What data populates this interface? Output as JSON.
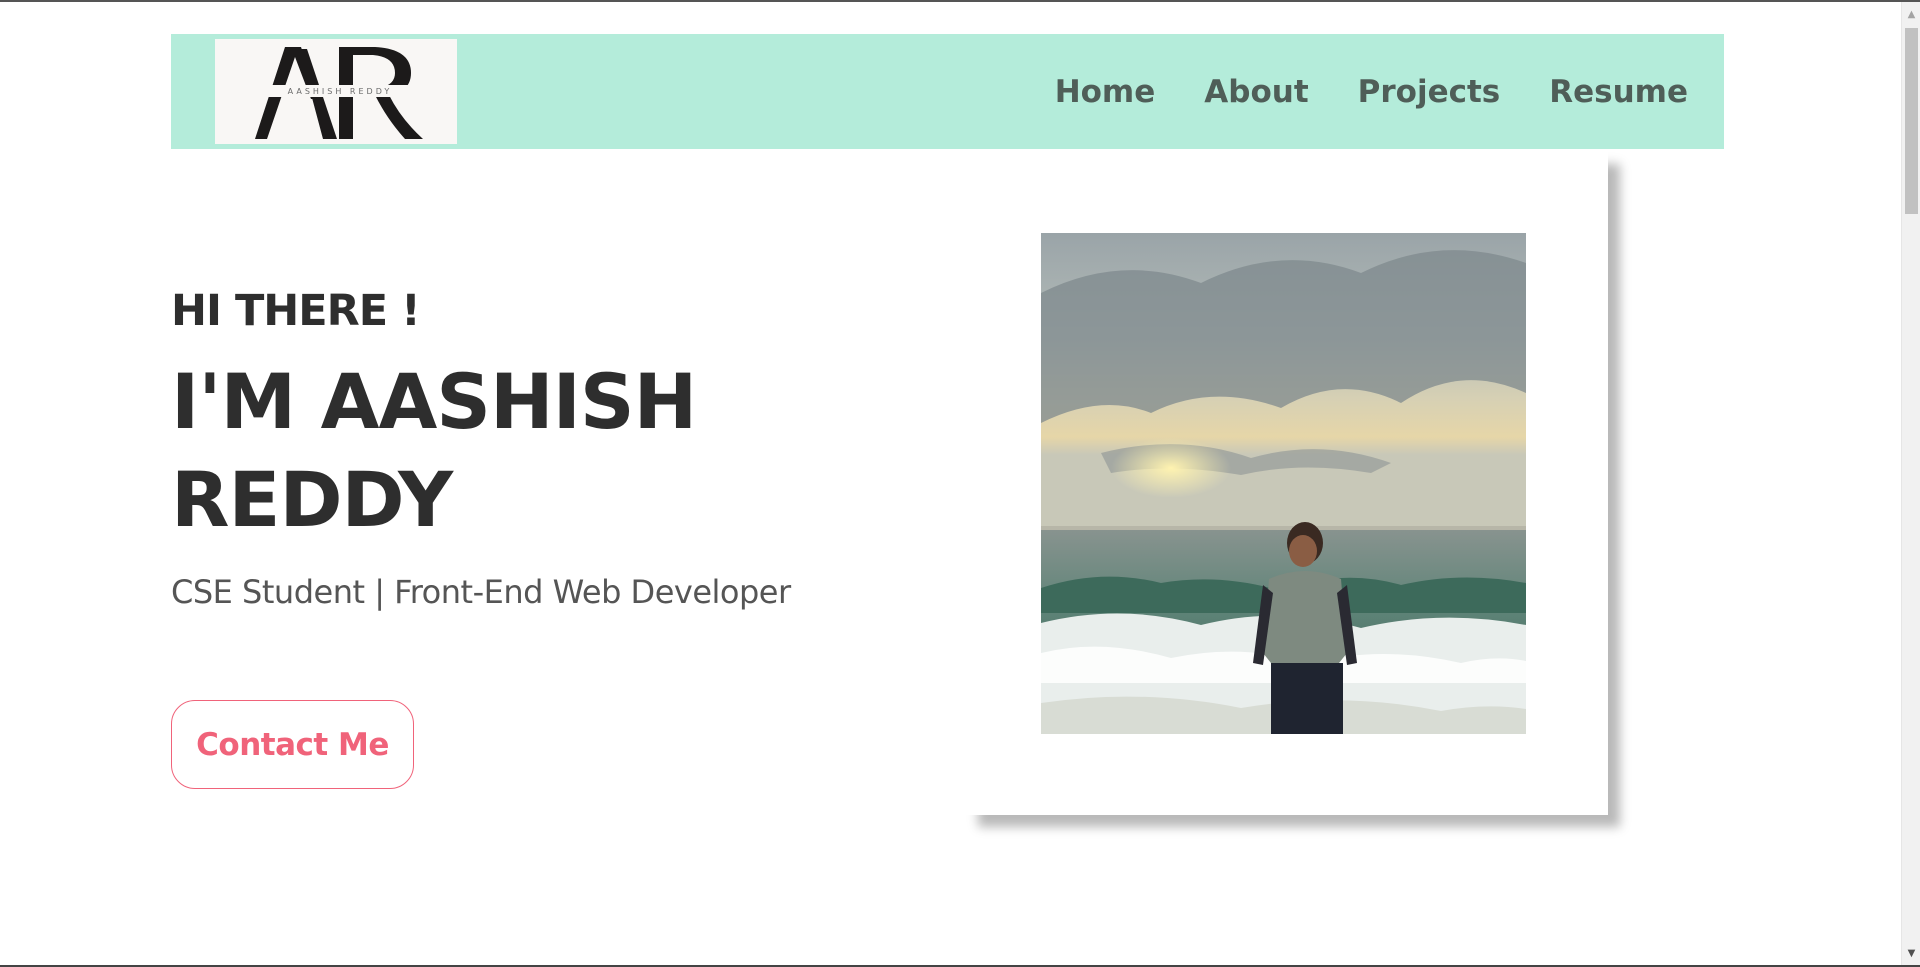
{
  "logo": {
    "letters": "AR",
    "subtitle": "AASHISH REDDY"
  },
  "nav": {
    "items": [
      {
        "label": "Home"
      },
      {
        "label": "About"
      },
      {
        "label": "Projects"
      },
      {
        "label": "Resume"
      }
    ]
  },
  "hero": {
    "greeting": "HI THERE !",
    "name_line1": "I'M AASHISH",
    "name_line2": "REDDY",
    "tagline": "CSE Student | Front-End Web Developer",
    "contact_label": "Contact Me"
  },
  "colors": {
    "header_bg": "#b4ecda",
    "nav_text": "#4f5e58",
    "accent": "#f0637a",
    "heading": "#2e2e2e"
  },
  "icons": {
    "scroll_up": "scroll-up-arrow-icon",
    "scroll_down": "scroll-down-arrow-icon"
  }
}
